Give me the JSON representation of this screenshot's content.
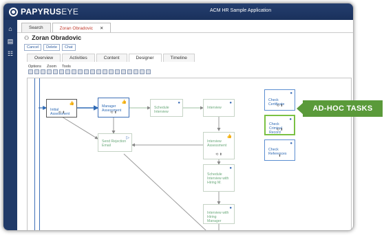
{
  "app": {
    "brand": "PAPYRUS",
    "brand_suffix": "EYE",
    "title": "ACM HR Sample Application"
  },
  "colors": {
    "topbar": "#1f3863",
    "annotation": "#5a9a3a",
    "highlight": "#7ac143",
    "link": "#2e6ab5"
  },
  "tabs": [
    {
      "label": "Search"
    },
    {
      "label": "Zoran Obradovic",
      "close": "✕"
    }
  ],
  "person": {
    "name": "Zoran Obradovic"
  },
  "buttons": [
    "Cancel",
    "Delete",
    "Chat"
  ],
  "subtabs": [
    "Overview",
    "Activities",
    "Content",
    "Designer",
    "Timeline"
  ],
  "menus": [
    "Options",
    "Zoom",
    "Tools"
  ],
  "nodes": {
    "initial": "Initial Assessment",
    "manager": "Manager Assessment",
    "schedule": "Schedule Interview",
    "interview": "Interview",
    "reject": "Send Rejection Email",
    "interview_assess": "Interview Assessment",
    "schedule_hiring": "Schedule Interview with Hiring M.",
    "interview_hiring": "Interview with Hiring Manager",
    "cert": "Check Certificate",
    "criminal": "Check Criminal Record",
    "refs": "Check References"
  },
  "annotation": "AD-HOC TASKS"
}
